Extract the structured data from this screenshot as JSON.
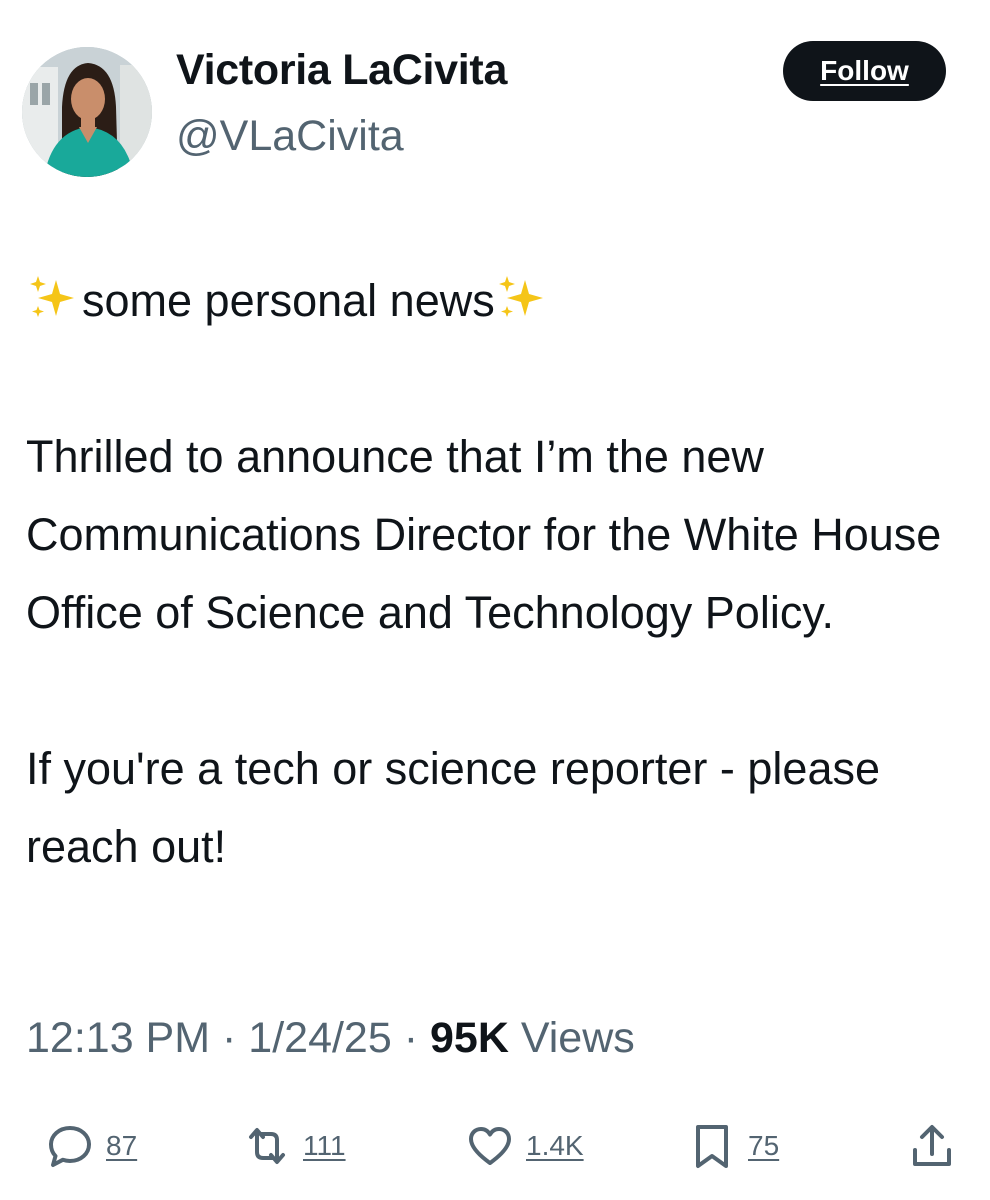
{
  "author": {
    "display_name": "Victoria LaCivita",
    "handle": "@VLaCivita",
    "avatar_icon": "profile-photo"
  },
  "follow_button": {
    "label": "Follow"
  },
  "tweet": {
    "sparkle_icon": "sparkles-emoji",
    "headline": "some personal news",
    "paragraph_1": "Thrilled to announce that I’m the new Communications Director for the White House Office of Science and Technology Policy.",
    "paragraph_2": "If you're a tech or science reporter - please reach out!"
  },
  "meta": {
    "time": "12:13 PM",
    "separator": "·",
    "date": "1/24/25",
    "views_count": "95K",
    "views_label": "Views"
  },
  "actions": {
    "replies": {
      "icon": "reply-icon",
      "count": "87"
    },
    "reposts": {
      "icon": "repost-icon",
      "count": "111"
    },
    "likes": {
      "icon": "heart-icon",
      "count": "1.4K"
    },
    "bookmarks": {
      "icon": "bookmark-icon",
      "count": "75"
    },
    "share": {
      "icon": "share-icon"
    }
  },
  "colors": {
    "text_primary": "#0f1419",
    "text_secondary": "#536471",
    "button_bg": "#0f1419",
    "button_text": "#ffffff",
    "sparkle": "#f5c518"
  }
}
